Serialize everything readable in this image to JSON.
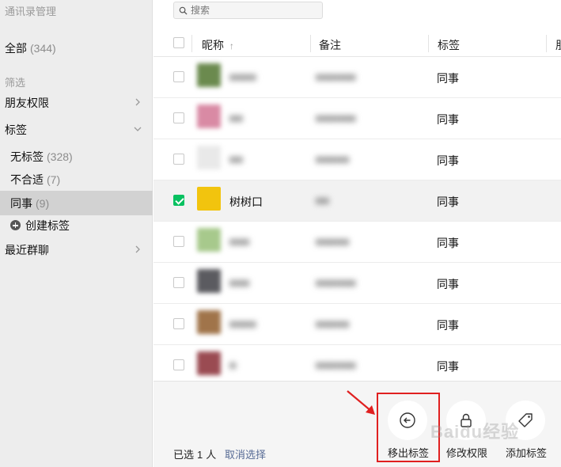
{
  "sidebar": {
    "title": "通讯录管理",
    "all": {
      "label": "全部",
      "count": "(344)"
    },
    "filter_label": "筛选",
    "friend_perms": "朋友权限",
    "tags_label": "标签",
    "tags": [
      {
        "label": "无标签",
        "count": "(328)"
      },
      {
        "label": "不合适",
        "count": "(7)"
      },
      {
        "label": "同事",
        "count": "(9)"
      }
    ],
    "create_tag": "创建标签",
    "recent_groups": "最近群聊"
  },
  "search": {
    "placeholder": "搜索"
  },
  "table": {
    "headers": {
      "nickname": "昵称",
      "sort_icon": "↑",
      "note": "备注",
      "tag": "标签",
      "extra": "朋"
    },
    "rows": [
      {
        "nickname": "■■■■",
        "note": "■■■■■■",
        "tag": "同事",
        "selected": false,
        "avatar": "#6b8a4e"
      },
      {
        "nickname": "■■",
        "note": "■■■■■■",
        "tag": "同事",
        "selected": false,
        "avatar": "#d98aa4"
      },
      {
        "nickname": "■■",
        "note": "■■■■■",
        "tag": "同事",
        "selected": false,
        "avatar": "#e9e9e9"
      },
      {
        "nickname": "树树口",
        "note": "■■",
        "tag": "同事",
        "selected": true,
        "avatar": "#f2c40e"
      },
      {
        "nickname": "■■■",
        "note": "■■■■■",
        "tag": "同事",
        "selected": false,
        "avatar": "#a7c98c"
      },
      {
        "nickname": "■■■",
        "note": "■■■■■■",
        "tag": "同事",
        "selected": false,
        "avatar": "#5b5b60"
      },
      {
        "nickname": "■■■■",
        "note": "■■■■■",
        "tag": "同事",
        "selected": false,
        "avatar": "#a0744a"
      },
      {
        "nickname": "■",
        "note": "■■■■■■",
        "tag": "同事",
        "selected": false,
        "avatar": "#9a4b52"
      }
    ]
  },
  "footer": {
    "selected_prefix": "已选",
    "selected_count": "1",
    "selected_suffix": "人",
    "cancel": "取消选择",
    "actions": {
      "remove": "移出标签",
      "permissions": "修改权限",
      "add": "添加标签"
    },
    "watermark": "Baidu经验"
  },
  "colors": {
    "accent": "#07c160",
    "highlight": "#e02020",
    "link": "#576b95"
  }
}
